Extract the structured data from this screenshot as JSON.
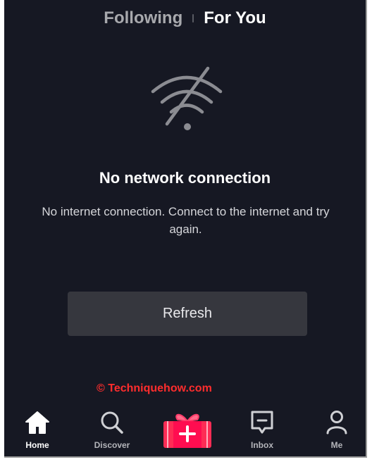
{
  "tabs": {
    "following": "Following",
    "for_you": "For You"
  },
  "error": {
    "icon": "wifi-off-icon",
    "title": "No network connection",
    "message": "No internet connection. Connect to the internet and try again.",
    "refresh_label": "Refresh"
  },
  "watermark": "© Techniquehow.com",
  "nav": {
    "home": "Home",
    "discover": "Discover",
    "inbox": "Inbox",
    "me": "Me"
  },
  "colors": {
    "background": "#161823",
    "button": "#36373e",
    "create_pink": "#fe2c55",
    "watermark": "#ff2d2d"
  }
}
